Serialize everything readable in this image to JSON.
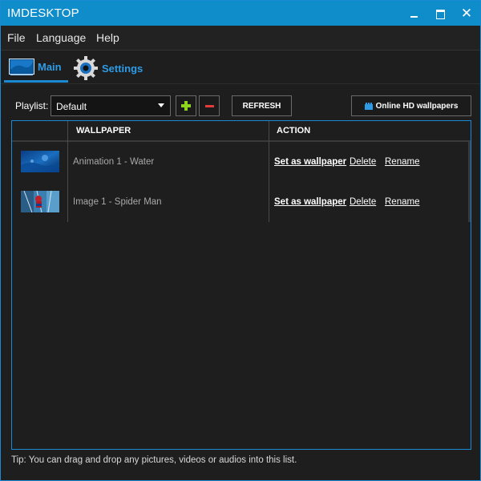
{
  "window": {
    "title": "IMDESKTOP",
    "accent": "#0f8cca"
  },
  "title_controls": {
    "minimize_icon": "minimize-icon",
    "maximize_icon": "maximize-icon",
    "close_glyph": "✕"
  },
  "menu": {
    "items": [
      "File",
      "Language",
      "Help"
    ]
  },
  "tabs": [
    {
      "label": "Main",
      "icon": "monitor-icon",
      "active": true
    },
    {
      "label": "Settings",
      "icon": "gear-icon",
      "active": false
    }
  ],
  "toolbar": {
    "playlist_label": "Playlist:",
    "playlist_selected": "Default",
    "refresh_label": "REFRESH",
    "online_label": "Online HD wallpapers"
  },
  "table": {
    "columns": [
      "WALLPAPER",
      "ACTION"
    ],
    "rows": [
      {
        "name": "Animation 1 - Water",
        "thumb": "water-thumbnail",
        "actions": [
          "Set as wallpaper",
          "Delete",
          "Rename"
        ]
      },
      {
        "name": "Image 1 - Spider Man",
        "thumb": "spiderman-thumbnail",
        "actions": [
          "Set as wallpaper",
          "Delete",
          "Rename"
        ]
      }
    ]
  },
  "tip": "Tip: You can drag and drop any pictures, videos or audios into this list.",
  "colors": {
    "add": "#8ed61e",
    "remove": "#e23b3b",
    "tab_text": "#2e9be6",
    "border": "#1a8ad4"
  }
}
